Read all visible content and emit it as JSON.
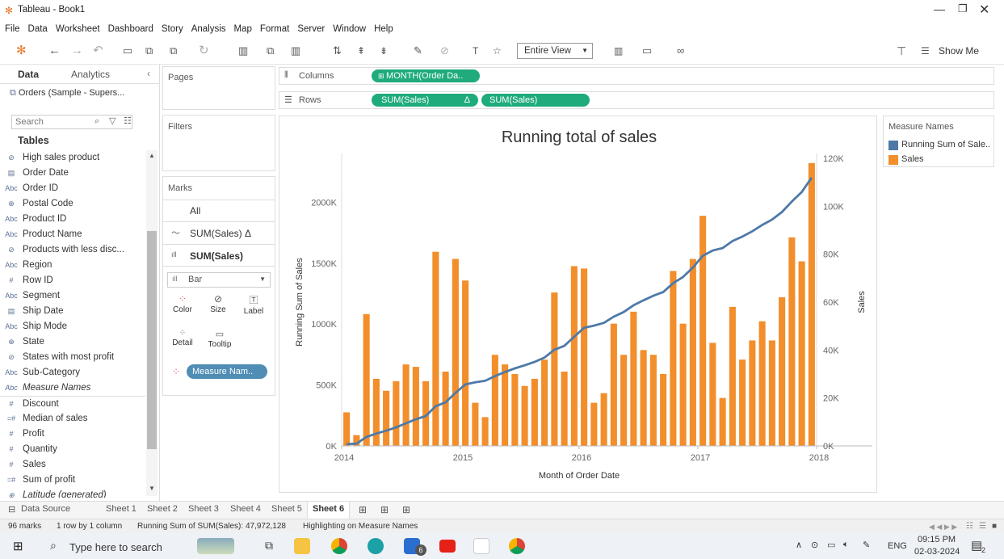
{
  "window": {
    "title": "Tableau - Book1"
  },
  "menu": [
    "File",
    "Data",
    "Worksheet",
    "Dashboard",
    "Story",
    "Analysis",
    "Map",
    "Format",
    "Server",
    "Window",
    "Help"
  ],
  "toolbar": {
    "view_select": "Entire View",
    "show_me": "Show Me"
  },
  "left_panel": {
    "tab_data": "Data",
    "tab_analytics": "Analytics",
    "datasource": "Orders (Sample - Supers...",
    "search_placeholder": "Search",
    "tables_label": "Tables",
    "fields": [
      {
        "icon": "set-icon",
        "glyph": "⊘",
        "name": "High sales product"
      },
      {
        "icon": "calendar-icon",
        "glyph": "▤",
        "name": "Order Date"
      },
      {
        "icon": "abc-icon",
        "glyph": "Abc",
        "name": "Order ID"
      },
      {
        "icon": "globe-icon",
        "glyph": "⊕",
        "name": "Postal Code"
      },
      {
        "icon": "abc-icon",
        "glyph": "Abc",
        "name": "Product ID"
      },
      {
        "icon": "abc-icon",
        "glyph": "Abc",
        "name": "Product Name"
      },
      {
        "icon": "set-icon",
        "glyph": "⊘",
        "name": "Products with less disc..."
      },
      {
        "icon": "abc-icon",
        "glyph": "Abc",
        "name": "Region"
      },
      {
        "icon": "number-icon",
        "glyph": "#",
        "name": "Row ID"
      },
      {
        "icon": "abc-icon",
        "glyph": "Abc",
        "name": "Segment"
      },
      {
        "icon": "calendar-icon",
        "glyph": "▤",
        "name": "Ship Date"
      },
      {
        "icon": "abc-icon",
        "glyph": "Abc",
        "name": "Ship Mode"
      },
      {
        "icon": "globe-icon",
        "glyph": "⊕",
        "name": "State"
      },
      {
        "icon": "set-icon",
        "glyph": "⊘",
        "name": "States with most profit"
      },
      {
        "icon": "abc-icon",
        "glyph": "Abc",
        "name": "Sub-Category"
      },
      {
        "icon": "abc-icon",
        "glyph": "Abc",
        "name": "Measure Names"
      },
      {
        "icon": "number-icon",
        "glyph": "#",
        "name": "Discount"
      },
      {
        "icon": "calc-number-icon",
        "glyph": "=#",
        "name": "Median of sales"
      },
      {
        "icon": "number-icon",
        "glyph": "#",
        "name": "Profit"
      },
      {
        "icon": "number-icon",
        "glyph": "#",
        "name": "Quantity"
      },
      {
        "icon": "number-icon",
        "glyph": "#",
        "name": "Sales"
      },
      {
        "icon": "calc-number-icon",
        "glyph": "=#",
        "name": "Sum of profit"
      },
      {
        "icon": "globe-icon",
        "glyph": "⊕",
        "name": "Latitude (generated)"
      }
    ]
  },
  "cards": {
    "pages": "Pages",
    "filters": "Filters",
    "marks": "Marks",
    "marks_all": "All",
    "marks_line": "SUM(Sales) Δ",
    "marks_bar": "SUM(Sales)",
    "mark_type": "Bar",
    "color": "Color",
    "size": "Size",
    "label": "Label",
    "detail": "Detail",
    "tooltip": "Tooltip",
    "measure_pill": "Measure Nam.."
  },
  "shelves": {
    "columns_label": "Columns",
    "rows_label": "Rows",
    "columns_pill": "MONTH(Order Da..",
    "rows_pill_1": "SUM(Sales)",
    "rows_pill_1_flag": "Δ",
    "rows_pill_2": "SUM(Sales)"
  },
  "legend": {
    "title": "Measure Names",
    "items": [
      {
        "label": "Running Sum of Sale..",
        "color": "#4e79a7"
      },
      {
        "label": "Sales",
        "color": "#f28e2b"
      }
    ]
  },
  "chart_data": {
    "type": "bar",
    "title": "Running total of sales",
    "xlabel": "Month of Order Date",
    "ylabel_left": "Running Sum of Sales",
    "ylabel_right": "Sales",
    "x_ticks": [
      "2014",
      "2015",
      "2016",
      "2017",
      "2018"
    ],
    "y_left_ticks": [
      "0K",
      "500K",
      "1000K",
      "1500K",
      "2000K"
    ],
    "y_right_ticks": [
      "0K",
      "20K",
      "40K",
      "60K",
      "80K",
      "100K",
      "120K"
    ],
    "y_left_range": [
      0,
      2400000
    ],
    "y_right_range": [
      0,
      122000
    ],
    "grid": false,
    "legend_position": "right",
    "colors": {
      "bars": "#f28e2b",
      "line": "#4e79a7"
    },
    "series": [
      {
        "name": "Sales",
        "axis": "right",
        "values": [
          14000,
          4500,
          55000,
          28000,
          23000,
          27000,
          34000,
          33000,
          27000,
          81000,
          31000,
          78000,
          69000,
          18000,
          12000,
          38000,
          34000,
          30000,
          25000,
          28000,
          36000,
          64000,
          31000,
          75000,
          74000,
          18000,
          22000,
          51000,
          38000,
          56000,
          40000,
          38000,
          30000,
          73000,
          51000,
          78000,
          96000,
          43000,
          20000,
          58000,
          36000,
          44000,
          52000,
          44000,
          62000,
          87000,
          77000,
          118000
        ]
      },
      {
        "name": "Running Sum of Sales",
        "axis": "left",
        "values": [
          14000,
          18500,
          73500,
          101500,
          124500,
          151500,
          185500,
          218500,
          245500,
          326500,
          357500,
          435500,
          504500,
          522500,
          534500,
          572500,
          606500,
          636500,
          661500,
          689500,
          725500,
          789500,
          820500,
          895500,
          969500,
          987500,
          1009500,
          1060500,
          1098500,
          1154500,
          1194500,
          1232500,
          1262500,
          1335500,
          1386500,
          1464500,
          1560500,
          1603500,
          1623500,
          1681500,
          1717500,
          1761500,
          1813500,
          1857500,
          1919500,
          2006500,
          2083500,
          2201500
        ]
      }
    ]
  },
  "sheets": {
    "data_source": "Data Source",
    "tabs": [
      "Sheet 1",
      "Sheet 2",
      "Sheet 3",
      "Sheet 4",
      "Sheet 5",
      "Sheet 6"
    ],
    "active": "Sheet 6"
  },
  "status": {
    "marks": "96 marks",
    "rows_cols": "1 row by 1 column",
    "running_sum": "Running Sum of SUM(Sales): 47,972,128",
    "highlight": "Highlighting on Measure Names"
  },
  "taskbar": {
    "search_placeholder": "Type here to search",
    "lang": "ENG",
    "time": "09:15 PM",
    "date": "02-03-2024",
    "mail_badge": "6",
    "notif_badge": "2"
  }
}
